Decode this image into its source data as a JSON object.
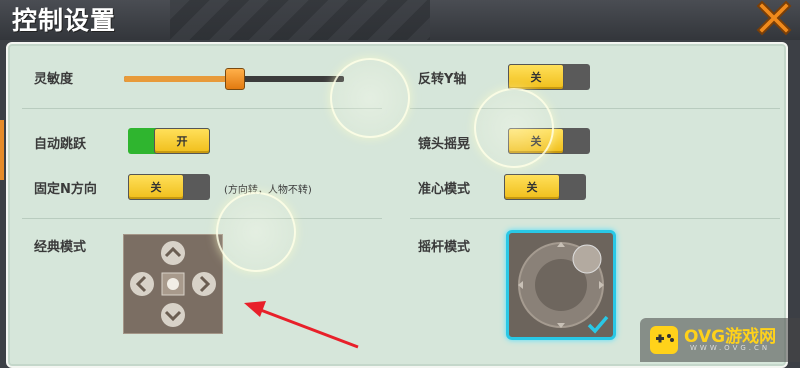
{
  "window": {
    "title": "控制设置",
    "close_icon": "close-x-icon",
    "accent_close": "#f08a1c"
  },
  "settings": {
    "sensitivity": {
      "label": "灵敏度",
      "level": 0.5
    },
    "auto_jump": {
      "label": "自动跳跃",
      "state": "开"
    },
    "fixed_n": {
      "label": "固定N方向",
      "state": "关",
      "note": "(方向转，人物不转)"
    },
    "classic_mode": {
      "label": "经典模式"
    },
    "invert_y": {
      "label": "反转Y轴",
      "state": "关"
    },
    "camera_shake": {
      "label": "镜头摇晃",
      "state": "关"
    },
    "crosshair": {
      "label": "准心模式",
      "state": "关"
    },
    "joystick_mode": {
      "label": "摇杆模式",
      "selected": true
    }
  },
  "watermark": {
    "brand": "OVG游戏网",
    "sub": "WWW.OVG.CN"
  },
  "colors": {
    "panel": "#d6e6da",
    "toggle_yellow": "#f5c51e",
    "on_green": "#2fb52f",
    "selected_cyan": "#29c8e6"
  }
}
